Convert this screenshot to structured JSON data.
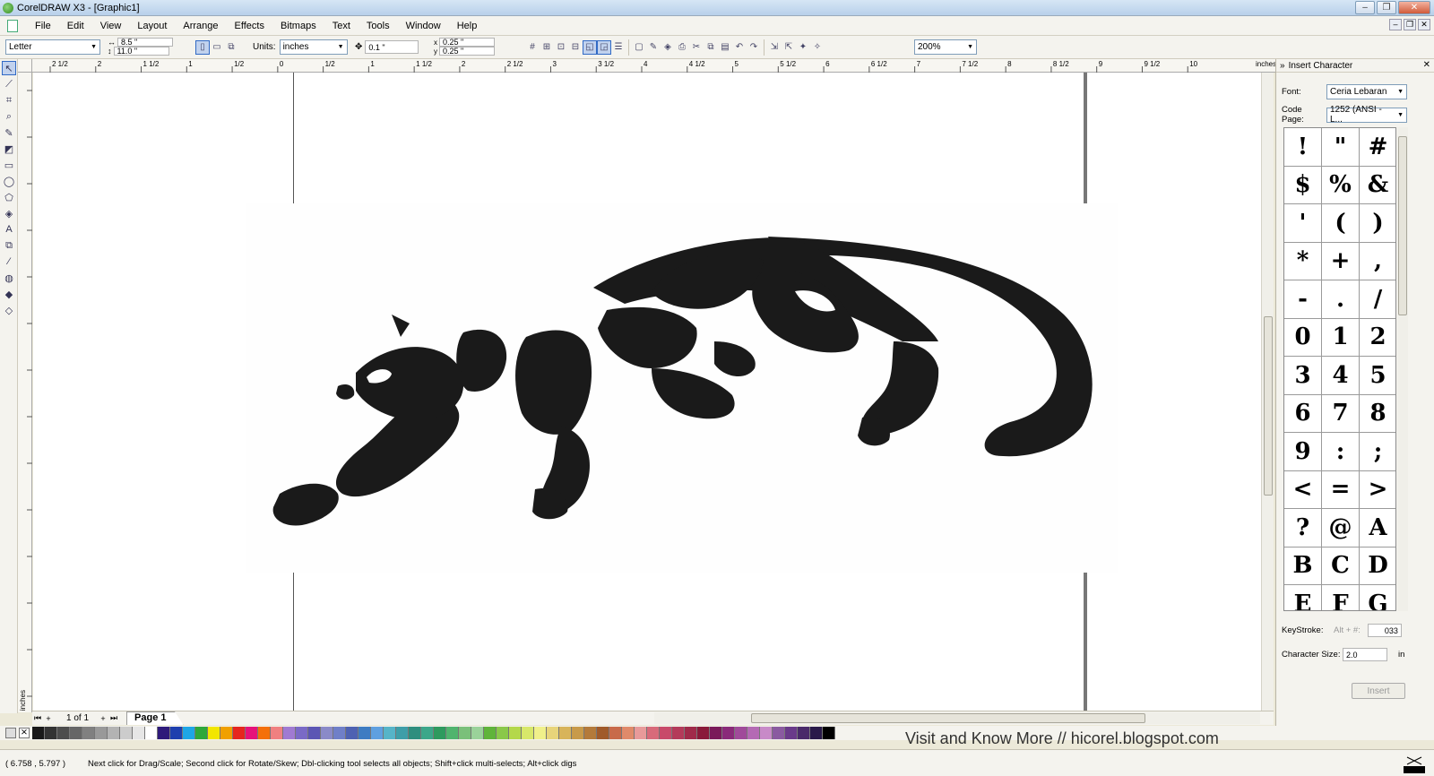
{
  "window": {
    "title": "CorelDRAW X3 - [Graphic1]"
  },
  "menu": [
    "File",
    "Edit",
    "View",
    "Layout",
    "Arrange",
    "Effects",
    "Bitmaps",
    "Text",
    "Tools",
    "Window",
    "Help"
  ],
  "propertybar": {
    "paper_size": "Letter",
    "width": "8.5 \"",
    "height": "11.0 \"",
    "units_label": "Units:",
    "units": "inches",
    "nudge": "0.1 \"",
    "dup_x": "0.25 \"",
    "dup_y": "0.25 \"",
    "zoom": "200%"
  },
  "ruler": {
    "top_labels": [
      "2 1/2",
      "2",
      "1 1/2",
      "1",
      "1/2",
      "0",
      "1/2",
      "1",
      "1 1/2",
      "2",
      "2 1/2",
      "3",
      "3 1/2",
      "4",
      "4 1/2",
      "5",
      "5 1/2",
      "6",
      "6 1/2",
      "7",
      "7 1/2",
      "8",
      "8 1/2",
      "9",
      "9 1/2",
      "10"
    ],
    "unit": "inches",
    "left_unit": "inches"
  },
  "pages": {
    "count": "1 of 1",
    "tab": "Page 1"
  },
  "docker": {
    "title": "Insert Character",
    "font_label": "Font:",
    "font_value": "Ceria Lebaran",
    "codepage_label": "Code Page:",
    "codepage_value": "1252  (ANSI - L...",
    "glyphs": [
      "!",
      "\"",
      "#",
      "$",
      "%",
      "&",
      "'",
      "(",
      ")",
      "*",
      "+",
      ",",
      "-",
      ".",
      "/",
      "0",
      "1",
      "2",
      "3",
      "4",
      "5",
      "6",
      "7",
      "8",
      "9",
      ":",
      ";",
      "<",
      "=",
      ">",
      "?",
      "@",
      "A",
      "B",
      "C",
      "D",
      "E",
      "F",
      "G"
    ],
    "keystroke_label": "KeyStroke:",
    "keystroke_alt": "Alt + #:",
    "keystroke_value": "033",
    "charsize_label": "Character Size:",
    "charsize_value": "2.0",
    "charsize_unit": "in",
    "insert_label": "Insert"
  },
  "palette_colors": [
    "#1a1a1a",
    "#333333",
    "#4d4d4d",
    "#666666",
    "#808080",
    "#999999",
    "#b3b3b3",
    "#cccccc",
    "#e6e6e6",
    "#ffffff",
    "#2e1a7a",
    "#1e3fae",
    "#1ea6e6",
    "#2ea83a",
    "#f2e600",
    "#f0a000",
    "#e6261e",
    "#e6127a",
    "#f4700a",
    "#f08080",
    "#a07ad2",
    "#7a6ac6",
    "#5c56b4",
    "#8a8ac8",
    "#6f7fc8",
    "#4e62b2",
    "#3e7cc2",
    "#5fa0e0",
    "#56b4c8",
    "#3e9ea8",
    "#2e8e7e",
    "#3ca78a",
    "#2e9a5e",
    "#50b46e",
    "#7ac07a",
    "#9ad29a",
    "#5fb43a",
    "#8ac84a",
    "#b4d84a",
    "#d8e86a",
    "#f0f08a",
    "#e8d47a",
    "#d8b45a",
    "#c89a4a",
    "#b47a3a",
    "#a05a2a",
    "#c86a4a",
    "#e08a6a",
    "#e89a9a",
    "#d86a7a",
    "#c84a6a",
    "#b43a5a",
    "#a02a4a",
    "#8a1a3a",
    "#7a1a5a",
    "#8a2a7a",
    "#a04a9a",
    "#b46ab4",
    "#c88ac8",
    "#8a5aa0",
    "#6a3a8a",
    "#4a2a6a",
    "#2a1a4a",
    "#000000"
  ],
  "watermark": "Visit and Know More // hicorel.blogspot.com",
  "status": {
    "coords": "( 6.758 , 5.797 )",
    "hint": "Next click for Drag/Scale; Second click for Rotate/Skew; Dbl-clicking tool selects all objects; Shift+click multi-selects; Alt+click digs"
  }
}
